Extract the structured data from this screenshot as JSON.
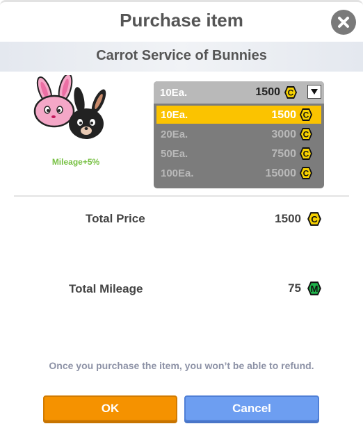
{
  "dialog": {
    "title": "Purchase item",
    "close_icon": "close-icon",
    "item_name": "Carrot Service of Bunnies",
    "mileage_bonus": "Mileage+5%"
  },
  "quantity_select": {
    "selected_qty": "10Ea.",
    "selected_price": "1500",
    "options": [
      {
        "qty": "10Ea.",
        "price": "1500"
      },
      {
        "qty": "20Ea.",
        "price": "3000"
      },
      {
        "qty": "50Ea.",
        "price": "7500"
      },
      {
        "qty": "100Ea.",
        "price": "15000"
      }
    ]
  },
  "summary": {
    "total_price_label": "Total Price",
    "total_price_value": "1500",
    "total_mileage_label": "Total Mileage",
    "total_mileage_value": "75"
  },
  "coin_icon_letter": "C",
  "mileage_icon_letter": "M",
  "refund_notice": "Once you purchase the item, you won’t be able to refund.",
  "buttons": {
    "ok": "OK",
    "cancel": "Cancel"
  },
  "colors": {
    "ok": "#f59200",
    "cancel": "#6d9ef1",
    "selected_option": "#fbc300",
    "coin": "#f6d100",
    "mileage": "#1fb34a"
  }
}
